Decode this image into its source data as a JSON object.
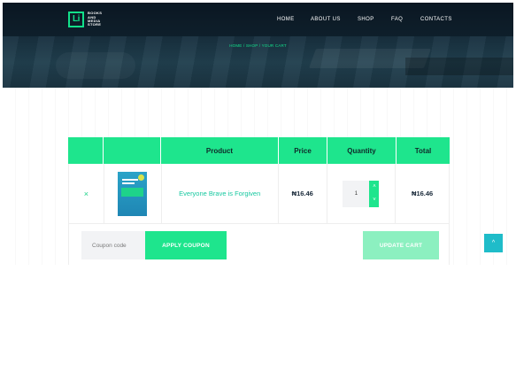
{
  "header": {
    "logo_mark": "Li",
    "logo_text": "BOOKS AND MEDIA STORE",
    "nav": [
      "HOME",
      "ABOUT US",
      "SHOP",
      "FAQ",
      "CONTACTS"
    ],
    "breadcrumb": "HOME / SHOP / YOUR CART"
  },
  "cart": {
    "columns": [
      "",
      "",
      "Product",
      "Price",
      "Quantity",
      "Total"
    ],
    "items": [
      {
        "remove": "×",
        "product": "Everyone Brave is Forgiven",
        "price": "₦16.46",
        "quantity": "1",
        "total": "₦16.46"
      }
    ],
    "coupon_placeholder": "Coupon code",
    "apply_label": "APPLY COUPON",
    "update_label": "UPDATE CART"
  },
  "scroll_top_icon": "^",
  "colors": {
    "accent": "#1ee58d",
    "accent_light": "#8cf0c0",
    "link": "#17c8a0",
    "header_bg": "#0f1d2b",
    "scroll_top": "#1fbcc9"
  }
}
